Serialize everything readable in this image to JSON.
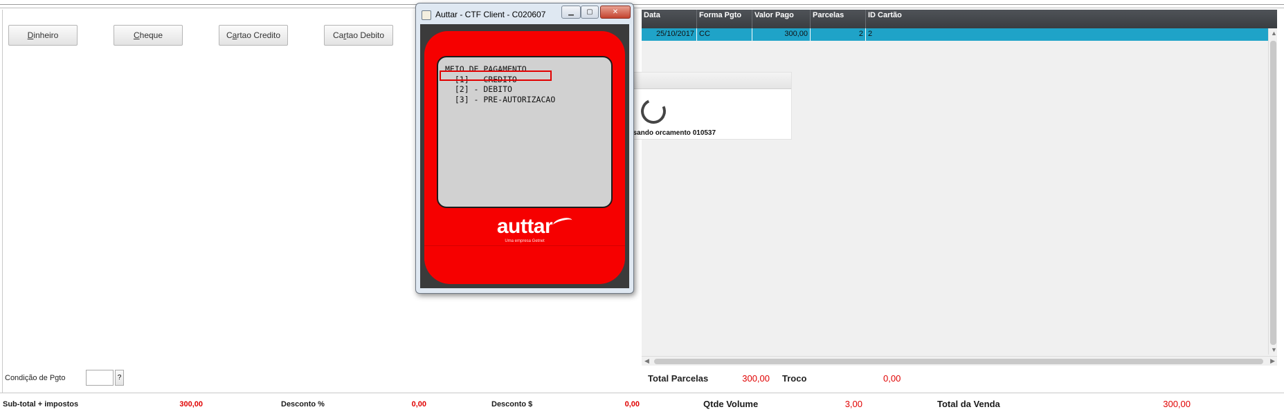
{
  "payment_buttons": [
    {
      "label": "Dinheiro",
      "accesskey": "D",
      "rest": "inheiro"
    },
    {
      "label": "Cheque",
      "accesskey": "C",
      "rest": "heque"
    },
    {
      "label": "Cartao Credito",
      "pre": "C",
      "accesskey": "a",
      "rest": "rtao Credito"
    },
    {
      "label": "Cartao Debito",
      "pre": "Ca",
      "accesskey": "r",
      "rest": "tao Debito"
    }
  ],
  "condition": {
    "label": "Condição de Pgto",
    "value": "",
    "help": "?"
  },
  "grid": {
    "columns": [
      "Data",
      "Forma Pgto",
      "Valor Pago",
      "Parcelas",
      "ID Cartão"
    ],
    "rows": [
      {
        "data": "25/10/2017",
        "forma": "CC",
        "valor": "300,00",
        "parcelas": "2",
        "id_cartao": "2"
      }
    ]
  },
  "loading": {
    "text": "ssando orcamento 010537"
  },
  "totals": {
    "total_parcelas_label": "Total Parcelas",
    "total_parcelas_value": "300,00",
    "troco_label": "Troco",
    "troco_value": "0,00"
  },
  "footer": {
    "subtotal_label": "Sub-total + impostos",
    "subtotal_value": "300,00",
    "desc_pct_label": "Desconto %",
    "desc_pct_value": "0,00",
    "desc_val_label": "Desconto $",
    "desc_val_value": "0,00",
    "qtde_label": "Qtde Volume",
    "qtde_value": "3,00",
    "total_label": "Total da Venda",
    "total_value": "300,00"
  },
  "dialog": {
    "title": "Auttar - CTF Client - C020607",
    "screen_lines": "MEIO DE PAGAMENTO\n  [1] - CREDITO\n  [2] - DEBITO\n  [3] - PRE-AUTORIZACAO",
    "brand": "auttar",
    "brand_sub": "Uma empresa Getnet",
    "progress": 0.5
  },
  "colors": {
    "accent_row": "#1fa3c8",
    "value_red": "#e00000",
    "device_red": "#f60000"
  }
}
